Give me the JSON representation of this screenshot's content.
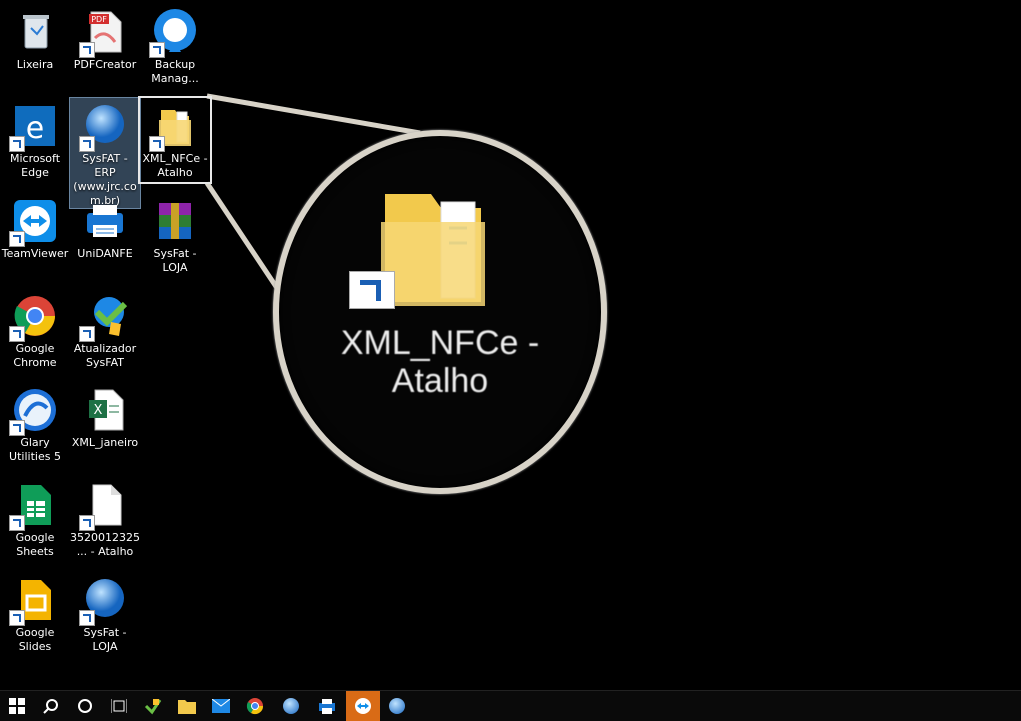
{
  "desktop": {
    "icons": [
      {
        "label": "Lixeira"
      },
      {
        "label": "PDFCreator"
      },
      {
        "label": "Backup Manag..."
      },
      {
        "label": "Microsoft Edge"
      },
      {
        "label": "SysFAT - ERP (www.jrc.com.br)"
      },
      {
        "label": "XML_NFCe - Atalho"
      },
      {
        "label": "TeamViewer"
      },
      {
        "label": "UniDANFE"
      },
      {
        "label": "SysFat - LOJA"
      },
      {
        "label": "Google Chrome"
      },
      {
        "label": "Atualizador SysFAT"
      },
      {
        "label": "Glary Utilities 5"
      },
      {
        "label": "XML_janeiro"
      },
      {
        "label": "Google Sheets"
      },
      {
        "label": "3520012325... - Atalho"
      },
      {
        "label": "Google Slides"
      },
      {
        "label": "SysFat - LOJA"
      }
    ]
  },
  "magnifier": {
    "text_line1": "XML_NFCe -",
    "text_line2": "Atalho"
  },
  "pdf_badge": "PDF",
  "taskbar": {
    "items": [
      "windows-start-icon",
      "search-icon",
      "cortana-icon",
      "task-view-icon",
      "sysfat-app-icon",
      "file-explorer-icon",
      "mail-icon",
      "chrome-icon",
      "sysfat-globe-icon",
      "unidanfe-icon",
      "teamviewer-icon",
      "sysfat-loja-icon"
    ]
  },
  "colors": {
    "highlight": "#d96b16",
    "selection": "#6e96be"
  }
}
